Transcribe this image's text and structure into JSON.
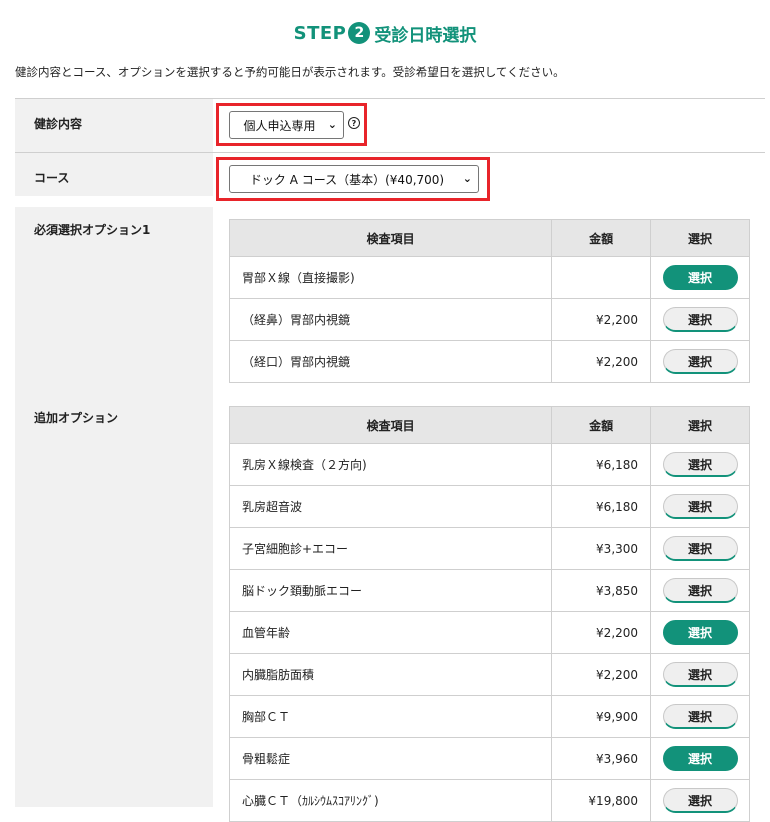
{
  "header": {
    "step_word": "STEP",
    "step_number": "2",
    "step_label": "受診日時選択",
    "accent_color": "#12927a"
  },
  "intro_text": "健診内容とコース、オプションを選択すると予約可能日が表示されます。受診希望日を選択してください。",
  "form": {
    "exam_type": {
      "label": "健診内容",
      "value": "個人申込専用",
      "help_icon": "question-circle-icon"
    },
    "course": {
      "label": "コース",
      "value": "ドック A コース（基本）(¥40,700)"
    }
  },
  "required_options": {
    "label": "必須選択オプション1",
    "headers": {
      "item": "検査項目",
      "price": "金額",
      "select": "選択"
    },
    "rows": [
      {
        "item": "胃部Ｘ線（直接撮影)",
        "price": "",
        "button": "選択",
        "selected": true
      },
      {
        "item": "（経鼻）胃部内視鏡",
        "price": "¥2,200",
        "button": "選択",
        "selected": false
      },
      {
        "item": "（経口）胃部内視鏡",
        "price": "¥2,200",
        "button": "選択",
        "selected": false
      }
    ]
  },
  "additional_options": {
    "label": "追加オプション",
    "headers": {
      "item": "検査項目",
      "price": "金額",
      "select": "選択"
    },
    "rows": [
      {
        "item": "乳房Ｘ線検査（２方向)",
        "price": "¥6,180",
        "button": "選択",
        "selected": false
      },
      {
        "item": "乳房超音波",
        "price": "¥6,180",
        "button": "選択",
        "selected": false
      },
      {
        "item": "子宮細胞診+エコー",
        "price": "¥3,300",
        "button": "選択",
        "selected": false
      },
      {
        "item": "脳ドック頚動脈エコー",
        "price": "¥3,850",
        "button": "選択",
        "selected": false
      },
      {
        "item": "血管年齢",
        "price": "¥2,200",
        "button": "選択",
        "selected": true
      },
      {
        "item": "内臓脂肪面積",
        "price": "¥2,200",
        "button": "選択",
        "selected": false
      },
      {
        "item": "胸部ＣＴ",
        "price": "¥9,900",
        "button": "選択",
        "selected": false
      },
      {
        "item": "骨粗鬆症",
        "price": "¥3,960",
        "button": "選択",
        "selected": true
      },
      {
        "item": "心臓ＣＴ（ｶﾙｼｳﾑｽｺｱﾘﾝｸﾞ)",
        "price": "¥19,800",
        "button": "選択",
        "selected": false
      }
    ]
  }
}
